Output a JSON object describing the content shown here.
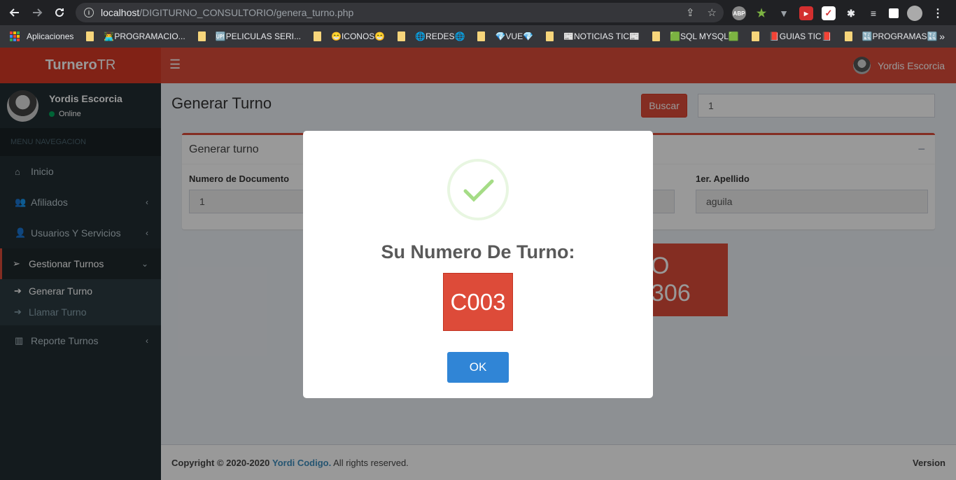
{
  "browser": {
    "url_host": "localhost",
    "url_path": "/DIGITURNO_CONSULTORIO/genera_turno.php",
    "back_icon": "arrow-left-icon",
    "forward_icon": "arrow-right-icon",
    "reload_icon": "reload-icon",
    "ext_abp": "ABP",
    "bookmarks": {
      "apps": "Aplicaciones",
      "items": [
        "👨‍💻PROGRAMACIO...",
        "🆙PELICULAS SERI...",
        "😁ICONOS😁",
        "🌐REDES🌐",
        "💎VUE💎",
        "📰NOTICIAS TIC📰",
        "🟩SQL MYSQL🟩",
        "📕GUIAS TIC📕",
        "🔣PROGRAMAS🔣"
      ],
      "more": "»"
    }
  },
  "app": {
    "logo_bold": "Turnero",
    "logo_light": "TR",
    "user_name": "Yordis Escorcia",
    "status": "Online",
    "menu_header": "MENU NAVEGACION",
    "menu": {
      "inicio": "Inicio",
      "afiliados": "Afiliados",
      "usuarios": "Usuarios Y Servicios",
      "gestionar": "Gestionar Turnos",
      "generar": "Generar Turno",
      "llamar": "Llamar Turno",
      "reporte": "Reporte Turnos"
    }
  },
  "page": {
    "title": "Generar Turno",
    "buscar_label": "Buscar",
    "buscar_value": "1",
    "box_title": "Generar turno",
    "doc_label": "Numero de Documento",
    "doc_value": "1",
    "apellido_label": "1er. Apellido",
    "apellido_value": "aguila",
    "turno_bg": "O 306"
  },
  "footer": {
    "copyright": "Copyright © 2020-2020",
    "brand": "Yordi Codigo.",
    "rights": "All rights reserved.",
    "version": "Version"
  },
  "modal": {
    "title": "Su Numero De Turno:",
    "turno": "C003",
    "ok_label": "OK"
  },
  "colors": {
    "primary_red": "#dd4b39",
    "sidebar_dark": "#222d32",
    "ok_blue": "#3085d6",
    "success_green": "#a5dc86"
  }
}
